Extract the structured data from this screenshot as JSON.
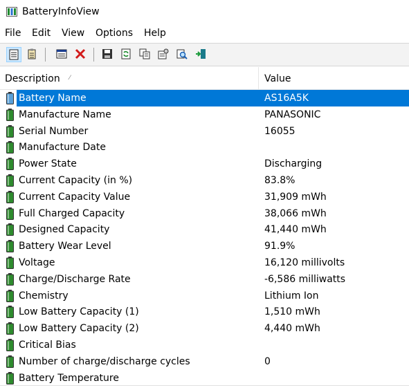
{
  "window": {
    "title": "BatteryInfoView"
  },
  "menu": [
    "File",
    "Edit",
    "View",
    "Options",
    "Help"
  ],
  "toolbar": [
    {
      "icon": "battery-info-view-icon",
      "active": true
    },
    {
      "icon": "battery-log-view-icon",
      "active": false
    },
    {
      "icon": "properties-window-icon",
      "active": false
    },
    {
      "icon": "delete-x-icon",
      "active": false
    },
    {
      "icon": "save-disk-icon",
      "active": false
    },
    {
      "icon": "refresh-icon",
      "active": false
    },
    {
      "icon": "copy-icon",
      "active": false
    },
    {
      "icon": "properties-icon",
      "active": false
    },
    {
      "icon": "find-icon",
      "active": false
    },
    {
      "icon": "exit-icon",
      "active": false
    }
  ],
  "columns": {
    "description": "Description",
    "value": "Value"
  },
  "rows": [
    {
      "description": "Battery Name",
      "value": "AS16A5K",
      "selected": true
    },
    {
      "description": "Manufacture Name",
      "value": "PANASONIC"
    },
    {
      "description": "Serial Number",
      "value": "16055"
    },
    {
      "description": "Manufacture Date",
      "value": ""
    },
    {
      "description": "Power State",
      "value": "Discharging"
    },
    {
      "description": "Current Capacity (in %)",
      "value": "83.8%"
    },
    {
      "description": "Current Capacity Value",
      "value": "31,909 mWh"
    },
    {
      "description": "Full Charged Capacity",
      "value": "38,066 mWh"
    },
    {
      "description": "Designed Capacity",
      "value": "41,440 mWh"
    },
    {
      "description": "Battery Wear Level",
      "value": "91.9%"
    },
    {
      "description": "Voltage",
      "value": "16,120 millivolts"
    },
    {
      "description": "Charge/Discharge Rate",
      "value": "-6,586 milliwatts"
    },
    {
      "description": "Chemistry",
      "value": "Lithium Ion"
    },
    {
      "description": "Low Battery Capacity (1)",
      "value": "1,510 mWh"
    },
    {
      "description": "Low Battery Capacity (2)",
      "value": "4,440 mWh"
    },
    {
      "description": "Critical Bias",
      "value": ""
    },
    {
      "description": "Number of charge/discharge cycles",
      "value": "0"
    },
    {
      "description": "Battery Temperature",
      "value": ""
    }
  ],
  "colors": {
    "selection": "#0078d7",
    "battery_green": "#2e8b2e",
    "battery_selected": "#5aa0d8"
  }
}
